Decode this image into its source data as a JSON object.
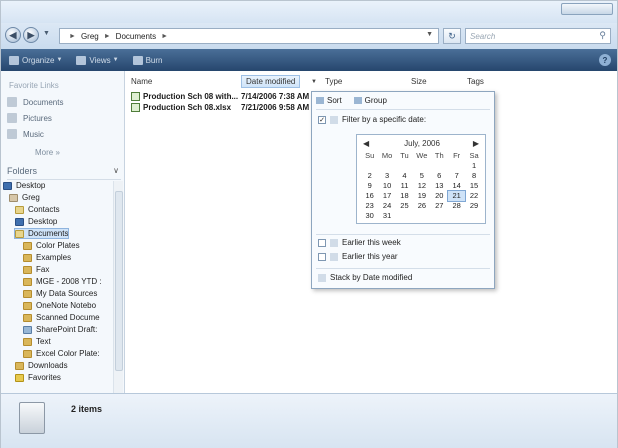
{
  "address": {
    "crumbs": [
      "Greg",
      "Documents"
    ],
    "search_placeholder": "Search"
  },
  "toolbar": {
    "organize_label": "Organize",
    "views_label": "Views",
    "burn_label": "Burn"
  },
  "navpane": {
    "favorites_head": "Favorite Links",
    "favorites": [
      "Documents",
      "Pictures",
      "Music"
    ],
    "more_label": "More",
    "folders_label": "Folders",
    "tree": [
      {
        "label": "Desktop",
        "level": 0,
        "icon": "desk"
      },
      {
        "label": "Greg",
        "level": 1,
        "icon": "user"
      },
      {
        "label": "Contacts",
        "level": 2,
        "icon": "doc"
      },
      {
        "label": "Desktop",
        "level": 2,
        "icon": "desk"
      },
      {
        "label": "Documents",
        "level": 2,
        "icon": "doc",
        "selected": true
      },
      {
        "label": "Color Plates",
        "level": 3,
        "icon": "folder"
      },
      {
        "label": "Examples",
        "level": 3,
        "icon": "folder"
      },
      {
        "label": "Fax",
        "level": 3,
        "icon": "folder"
      },
      {
        "label": "MGE - 2008 YTD :",
        "level": 3,
        "icon": "folder"
      },
      {
        "label": "My Data Sources",
        "level": 3,
        "icon": "folder"
      },
      {
        "label": "OneNote Notebo",
        "level": 3,
        "icon": "folder"
      },
      {
        "label": "Scanned Docume",
        "level": 3,
        "icon": "folder"
      },
      {
        "label": "SharePoint Draft:",
        "level": 3,
        "icon": "net"
      },
      {
        "label": "Text",
        "level": 3,
        "icon": "folder"
      },
      {
        "label": "Excel Color Plate:",
        "level": 3,
        "icon": "folder"
      },
      {
        "label": "Downloads",
        "level": 2,
        "icon": "folder"
      },
      {
        "label": "Favorites",
        "level": 2,
        "icon": "star"
      }
    ]
  },
  "filelist": {
    "columns": [
      "Name",
      "Date modified",
      "Type",
      "Size",
      "Tags"
    ],
    "rows": [
      {
        "name": "Production Sch 08 with...",
        "date": "7/14/2006 7:38 AM"
      },
      {
        "name": "Production Sch 08.xlsx",
        "date": "7/21/2006 9:58 AM"
      }
    ]
  },
  "filter": {
    "sort_label": "Sort",
    "group_label": "Group",
    "filter_label": "Filter by a specific date:",
    "calendar": {
      "month_label": "July, 2006",
      "days": [
        "Su",
        "Mo",
        "Tu",
        "We",
        "Th",
        "Fr",
        "Sa"
      ],
      "weeks": [
        [
          "",
          "",
          "",
          "",
          "",
          "",
          "1"
        ],
        [
          "2",
          "3",
          "4",
          "5",
          "6",
          "7",
          "8"
        ],
        [
          "9",
          "10",
          "11",
          "12",
          "13",
          "14",
          "15"
        ],
        [
          "16",
          "17",
          "18",
          "19",
          "20",
          "21",
          "22"
        ],
        [
          "23",
          "24",
          "25",
          "26",
          "27",
          "28",
          "29"
        ],
        [
          "30",
          "31",
          "",
          "",
          "",
          "",
          ""
        ]
      ],
      "selected_day": "21"
    },
    "earlier_week": "Earlier this week",
    "earlier_year": "Earlier this year",
    "stack_label": "Stack by Date modified"
  },
  "details": {
    "count": "2 items"
  }
}
